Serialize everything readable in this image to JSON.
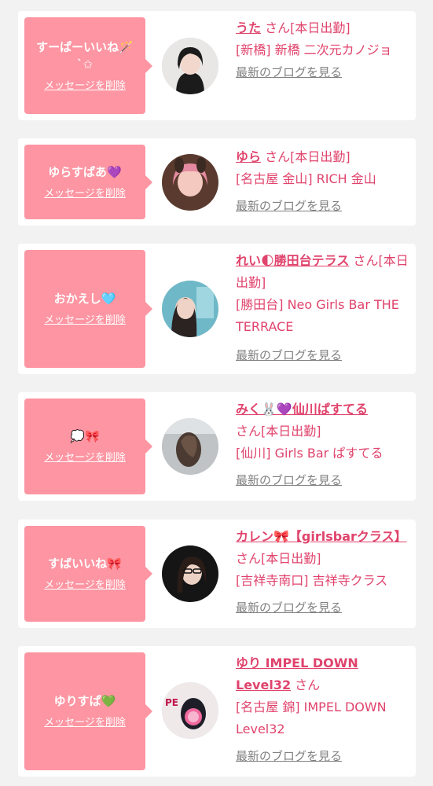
{
  "entries": [
    {
      "message": "すーぱーいいね🪄ˋ✩",
      "delete_label": "メッセージを削除",
      "name": "うた",
      "san": "さん",
      "status": "[本日出勤]",
      "shop": "[新橋] 新橋 二次元カノジョ",
      "blog_label": "最新のブログを見る"
    },
    {
      "message": "ゆらすぱあ💜",
      "delete_label": "メッセージを削除",
      "name": "ゆら",
      "san": "さん",
      "status": "[本日出勤]",
      "shop": "[名古屋 金山] RICH 金山",
      "blog_label": "最新のブログを見る"
    },
    {
      "message": "おかえし🩵",
      "delete_label": "メッセージを削除",
      "name": "れい🌓勝田台テラス",
      "san": "さん",
      "status": "[本日出勤]",
      "shop": "[勝田台] Neo Girls Bar THE TERRACE",
      "blog_label": "最新のブログを見る"
    },
    {
      "message": "💭🎀",
      "delete_label": "メッセージを削除",
      "name": "みく🐰💜仙川ぱすてる",
      "san": "さん",
      "status": "[本日出勤]",
      "shop": "[仙川] Girls Bar ぱすてる",
      "blog_label": "最新のブログを見る"
    },
    {
      "message": "すばいいね🎀",
      "delete_label": "メッセージを削除",
      "name": "カレン🎀【girlsbarクラス】",
      "san": "さん",
      "status": "[本日出勤]",
      "shop": "[吉祥寺南口] 吉祥寺クラス",
      "blog_label": "最新のブログを見る"
    },
    {
      "message": "ゆりすぱ💚",
      "delete_label": "メッセージを削除",
      "name": "ゆり IMPEL DOWN Level32",
      "san": "さん",
      "status": "",
      "shop": "[名古屋 錦] IMPEL DOWN Level32",
      "blog_label": "最新のブログを見る"
    }
  ],
  "colors": {
    "background": "#f2f2f2",
    "card": "#ffffff",
    "bubble": "#fd95a2",
    "accent": "#e0436c",
    "link_gray": "#808080"
  }
}
